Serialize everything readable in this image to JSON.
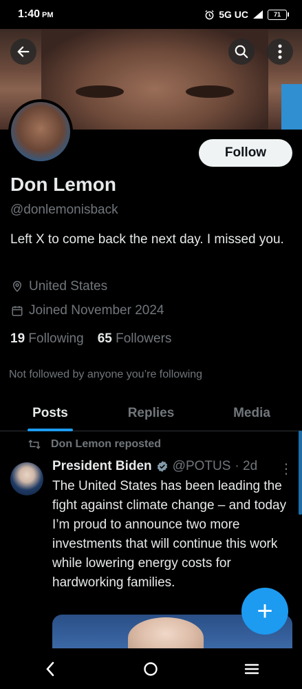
{
  "status_bar": {
    "time": "1:40",
    "ampm": "PM",
    "network": "5G UC",
    "battery": "71",
    "icons": [
      "alarm-icon",
      "signal-icon",
      "battery-icon"
    ]
  },
  "header": {
    "back_icon": "back-arrow-icon",
    "search_icon": "search-icon",
    "more_icon": "more-vertical-icon"
  },
  "profile": {
    "name": "Don Lemon",
    "handle": "@donlemonisback",
    "bio": "Left X to come back the next day. I missed you.",
    "location": "United States",
    "joined": "Joined November 2024",
    "following_count": "19",
    "following_label": "Following",
    "followers_count": "65",
    "followers_label": "Followers",
    "not_followed": "Not followed by anyone you’re following",
    "follow_button": "Follow"
  },
  "tabs": [
    {
      "label": "Posts",
      "active": true
    },
    {
      "label": "Replies",
      "active": false
    },
    {
      "label": "Media",
      "active": false
    }
  ],
  "post": {
    "repost_label": "Don Lemon reposted",
    "author_name": "President Biden",
    "author_handle": "@POTUS",
    "time": "· 2d",
    "text": "The United States has been leading the fight against climate change – and today I’m proud to announce two more investments that will continue this work while lowering energy costs for hardworking families."
  },
  "fab_label": "+",
  "colors": {
    "accent": "#1d9bf0",
    "text_primary": "#e7e9ea",
    "text_secondary": "#71767b",
    "background": "#000000"
  }
}
